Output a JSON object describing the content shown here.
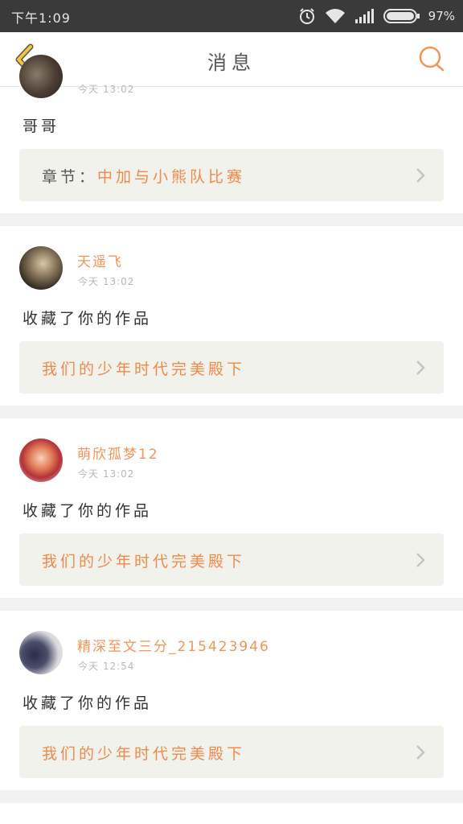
{
  "status_bar": {
    "time": "下午1:09",
    "battery_percent": "97%",
    "icons": [
      "alarm-icon",
      "wifi-icon",
      "signal-icon",
      "battery-icon"
    ]
  },
  "header": {
    "title": "消息",
    "back_icon": "chevron-left-icon",
    "search_icon": "search-icon"
  },
  "colors": {
    "accent": "#f08a4b",
    "back_icon": "#f6c53a",
    "status_bar_bg": "#3a3a3a",
    "link_box_bg": "#f2f2ec"
  },
  "messages": [
    {
      "user": "",
      "time": "今天 13:02",
      "action": "哥哥",
      "link_prefix": "章节：",
      "link": "中加与小熊队比赛"
    },
    {
      "user": "天遥飞",
      "time": "今天 13:02",
      "action": "收藏了你的作品",
      "link_prefix": "",
      "link": "我们的少年时代完美殿下"
    },
    {
      "user": "萌欣孤梦12",
      "time": "今天 13:02",
      "action": "收藏了你的作品",
      "link_prefix": "",
      "link": "我们的少年时代完美殿下"
    },
    {
      "user": "精深至文三分_215423946",
      "time": "今天 12:54",
      "action": "收藏了你的作品",
      "link_prefix": "",
      "link": "我们的少年时代完美殿下"
    }
  ]
}
